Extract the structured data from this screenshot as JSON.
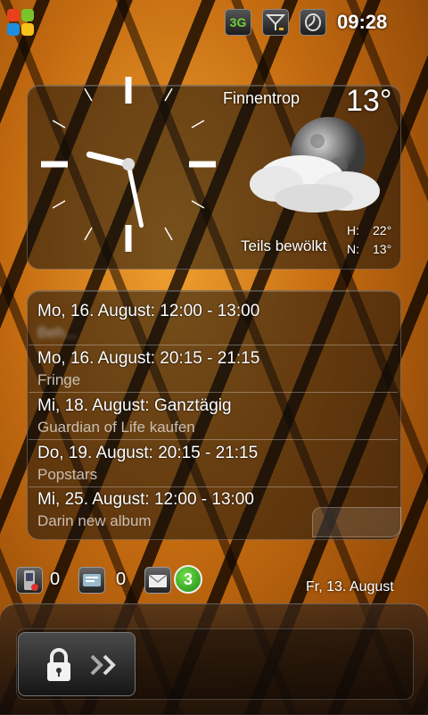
{
  "status_bar": {
    "time": "09:28",
    "network": "3G",
    "icons": [
      "windows-start-icon",
      "3g-icon",
      "signal-icon",
      "sound-icon"
    ]
  },
  "weather": {
    "city": "Finnentrop",
    "temperature": "13°",
    "condition": "Teils bewölkt",
    "high_label": "H:",
    "high": "22°",
    "low_label": "N:",
    "low": "13°",
    "icon": "cloudy-moon-icon"
  },
  "analog_clock": {
    "hour": 9,
    "minute": 28
  },
  "calendar": {
    "events": [
      {
        "date": "Mo, 16. August: 12:00 - 13:00",
        "title": "Beh..."
      },
      {
        "date": "Mo, 16. August: 20:15 - 21:15",
        "title": "Fringe"
      },
      {
        "date": "Mi, 18. August: Ganztägig",
        "title": "Guardian of Life kaufen"
      },
      {
        "date": "Do, 19. August: 20:15 - 21:15",
        "title": "Popstars"
      },
      {
        "date": "Mi, 25. August: 12:00 - 13:00",
        "title": "Darin new album"
      }
    ]
  },
  "notifications": {
    "missed_calls": "0",
    "sms": "0",
    "email_badge": "3",
    "date": "Fr, 13. August"
  },
  "colors": {
    "badge": "#2ea01c",
    "background": "#c36a10"
  }
}
